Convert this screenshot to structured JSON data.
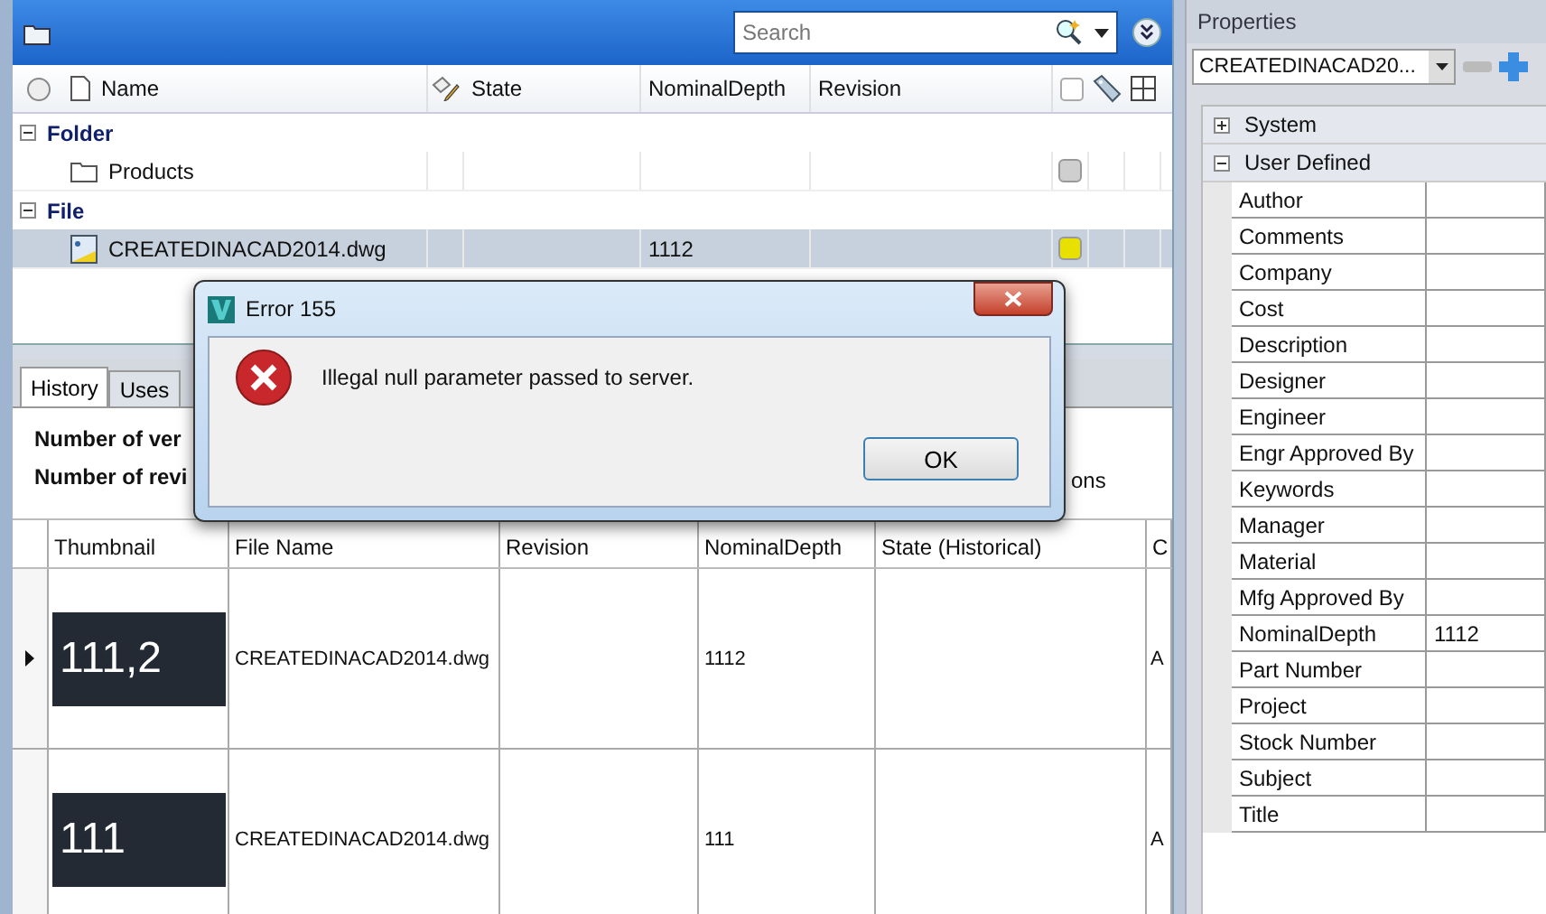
{
  "vault_pane": {
    "search": {
      "placeholder": "Search"
    },
    "columns": [
      {
        "label": "Name"
      },
      {
        "label": "State"
      },
      {
        "label": "NominalDepth"
      },
      {
        "label": "Revision"
      }
    ],
    "groups": [
      {
        "label": "Folder",
        "expanded": true,
        "rows": [
          {
            "kind": "folder",
            "name": "Products",
            "color": "#cfcfcf",
            "selected": false
          }
        ]
      },
      {
        "label": "File",
        "expanded": true,
        "rows": [
          {
            "kind": "drawing",
            "name": "CREATEDINACAD2014.dwg",
            "nominal_depth": "1112",
            "color": "#e8e000",
            "selected": true
          }
        ]
      }
    ]
  },
  "detail_pane": {
    "tabs": [
      {
        "label": "History",
        "selected": true
      },
      {
        "label": "Uses",
        "selected": false
      }
    ],
    "summary": [
      "Number of ver",
      "Number of revi"
    ],
    "summary_tail": "ons",
    "columns": [
      "Thumbnail",
      "File Name",
      "Revision",
      "NominalDepth",
      "State (Historical)",
      "C"
    ],
    "rows": [
      {
        "selected": true,
        "thumbnail_text": "111,2",
        "file_name": "CREATEDINACAD2014.dwg",
        "nominal_depth": "1112",
        "column_6": "A"
      },
      {
        "selected": false,
        "thumbnail_text": "111",
        "file_name": "CREATEDINACAD2014.dwg",
        "nominal_depth": "111",
        "column_6": "A"
      }
    ]
  },
  "properties": {
    "title": "Properties",
    "selector": "CREATEDINACAD20...",
    "groups": [
      {
        "label": "System",
        "expanded": false
      },
      {
        "label": "User Defined",
        "expanded": true,
        "items": [
          {
            "name": "Author"
          },
          {
            "name": "Comments"
          },
          {
            "name": "Company"
          },
          {
            "name": "Cost"
          },
          {
            "name": "Description"
          },
          {
            "name": "Designer"
          },
          {
            "name": "Engineer"
          },
          {
            "name": "Engr Approved By"
          },
          {
            "name": "Keywords"
          },
          {
            "name": "Manager"
          },
          {
            "name": "Material"
          },
          {
            "name": "Mfg Approved By"
          },
          {
            "name": "NominalDepth",
            "value": "1112"
          },
          {
            "name": "Part Number"
          },
          {
            "name": "Project"
          },
          {
            "name": "Stock Number"
          },
          {
            "name": "Subject"
          },
          {
            "name": "Title"
          }
        ]
      }
    ]
  },
  "dialog": {
    "title": "Error 155",
    "message": "Illegal null parameter passed to server.",
    "button": "OK"
  }
}
